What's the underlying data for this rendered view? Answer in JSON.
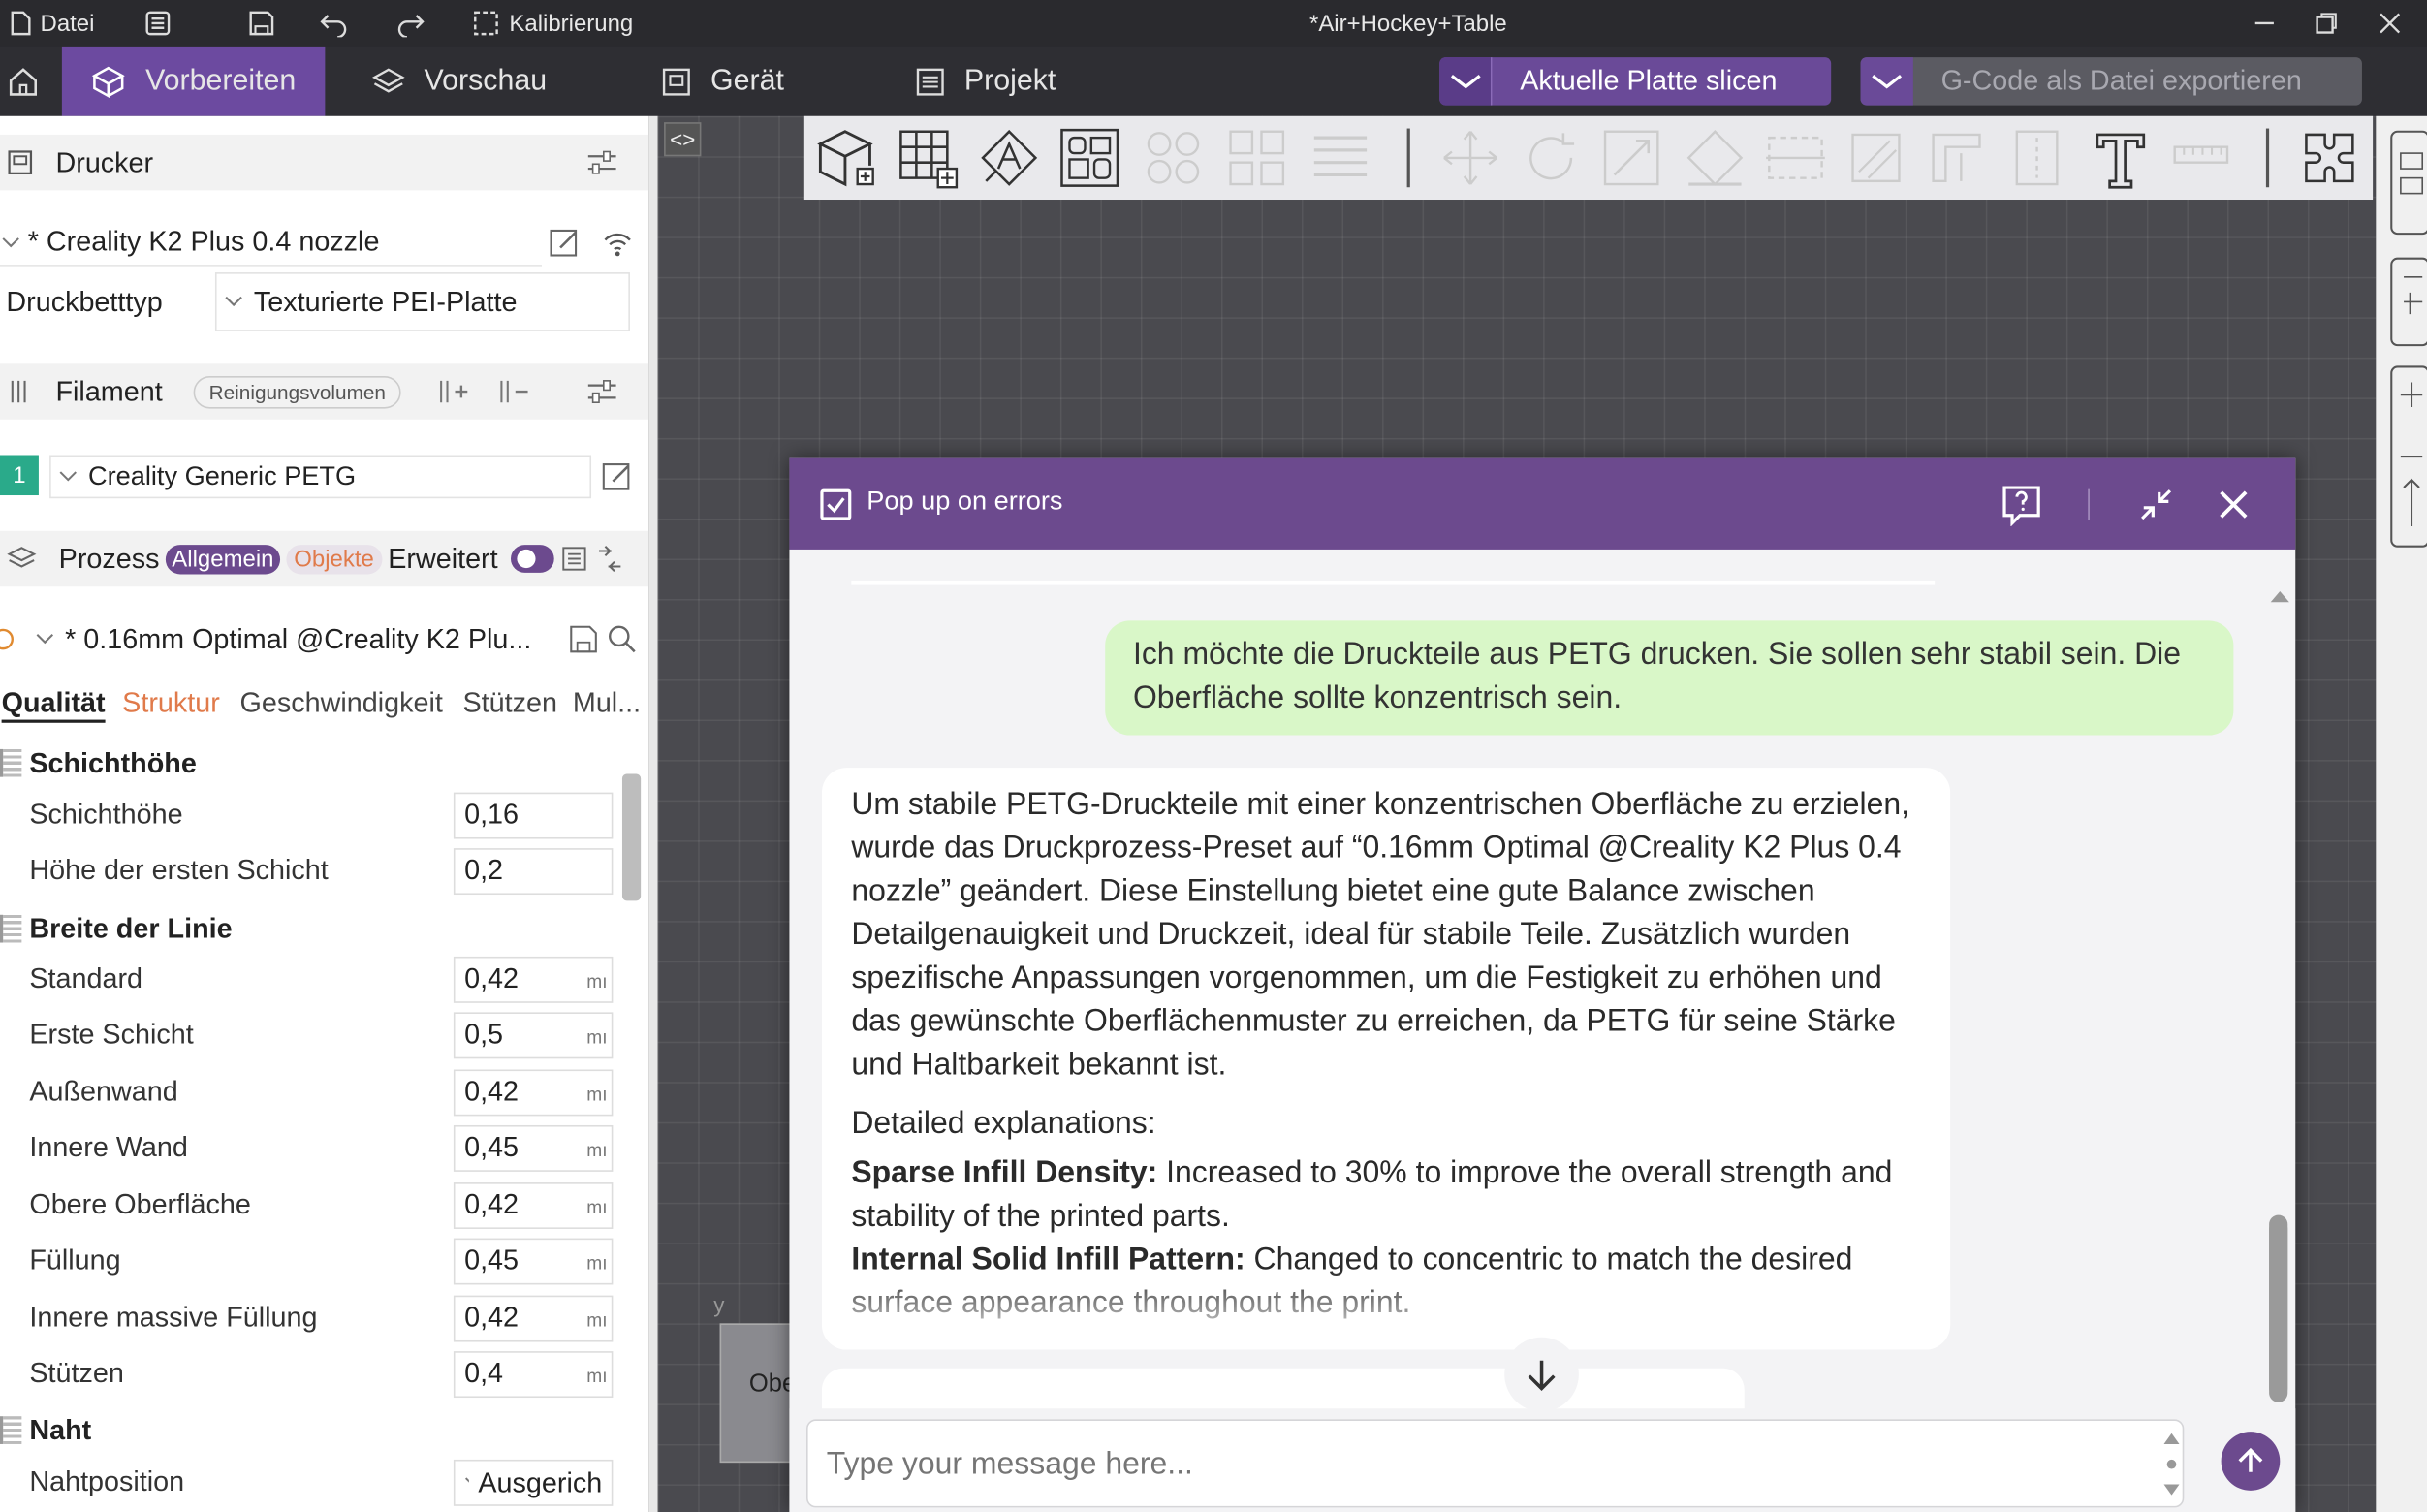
{
  "titlebar": {
    "file": "Datei",
    "calibration": "Kalibrierung",
    "title": "*Air+Hockey+Table"
  },
  "tabs": [
    {
      "label": "Vorbereiten"
    },
    {
      "label": "Vorschau"
    },
    {
      "label": "Gerät"
    },
    {
      "label": "Projekt"
    }
  ],
  "actions": {
    "slice": "Aktuelle Platte slicen",
    "export": "G-Code als Datei exportieren"
  },
  "printer": {
    "section": "Drucker",
    "name": "* Creality K2 Plus 0.4 nozzle",
    "bed_label": "Druckbetttyp",
    "bed_value": "Texturierte PEI-Platte"
  },
  "filament": {
    "section": "Filament",
    "purge": "Reinigungsvolumen",
    "slot": "1",
    "name": "Creality Generic PETG",
    "slot_color": "#2aaa8a"
  },
  "process": {
    "section": "Prozess",
    "mode_general": "Allgemein",
    "mode_objects": "Objekte",
    "advanced": "Erweitert",
    "preset": "* 0.16mm Optimal @Creality K2 Plu..."
  },
  "subtabs": [
    "Qualität",
    "Struktur",
    "Geschwindigkeit",
    "Stützen",
    "Mul..."
  ],
  "groups": {
    "layer": "Schichthöhe",
    "width": "Breite der Linie",
    "seam": "Naht"
  },
  "layer_rows": [
    {
      "name": "Schichthöhe",
      "value": "0,16"
    },
    {
      "name": "Höhe der ersten Schicht",
      "value": "0,2"
    }
  ],
  "width_rows": [
    {
      "name": "Standard",
      "value": "0,42",
      "unit": "mı"
    },
    {
      "name": "Erste Schicht",
      "value": "0,5",
      "unit": "mı"
    },
    {
      "name": "Außenwand",
      "value": "0,42",
      "unit": "mı"
    },
    {
      "name": "Innere Wand",
      "value": "0,45",
      "unit": "mı"
    },
    {
      "name": "Obere Oberfläche",
      "value": "0,42",
      "unit": "mı"
    },
    {
      "name": "Füllung",
      "value": "0,45",
      "unit": "mı"
    },
    {
      "name": "Innere massive Füllung",
      "value": "0,42",
      "unit": "mı"
    },
    {
      "name": "Stützen",
      "value": "0,4",
      "unit": "mı"
    }
  ],
  "seam_row": {
    "name": "Nahtposition",
    "value": "Ausgerich"
  },
  "viewport": {
    "plate_label": "Obe",
    "axis_label": "y"
  },
  "chat": {
    "popup": "Pop up on errors",
    "user_msg": "Ich möchte die Druckteile aus PETG drucken. Sie sollen sehr stabil sein. Die Oberfläche sollte konzentrisch sein.",
    "assistant_msg": "Um stabile PETG-Druckteile mit einer konzentrischen Oberfläche zu erzielen, wurde das Druckprozess-Preset auf “0.16mm Optimal @Creality K2 Plus 0.4 nozzle” geändert. Diese Einstellung bietet eine gute Balance zwischen Detailgenauigkeit und Druckzeit, ideal für stabile Teile. Zusätzlich wurden spezifische Anpassungen vorgenommen, um die Festigkeit zu erhöhen und das gewünschte Oberflächenmuster zu erreichen, da PETG für seine Stärke und Haltbarkeit bekannt ist.",
    "explain_title": "Detailed explanations:",
    "items": [
      {
        "key": "Sparse Infill Density:",
        "text": " Increased to 30% to improve the overall strength and stability of the printed parts."
      },
      {
        "key": "Internal Solid Infill Pattern:",
        "text": " Changed to concentric to match the desired surface appearance throughout the print."
      }
    ],
    "input_placeholder": "Type your message here..."
  }
}
